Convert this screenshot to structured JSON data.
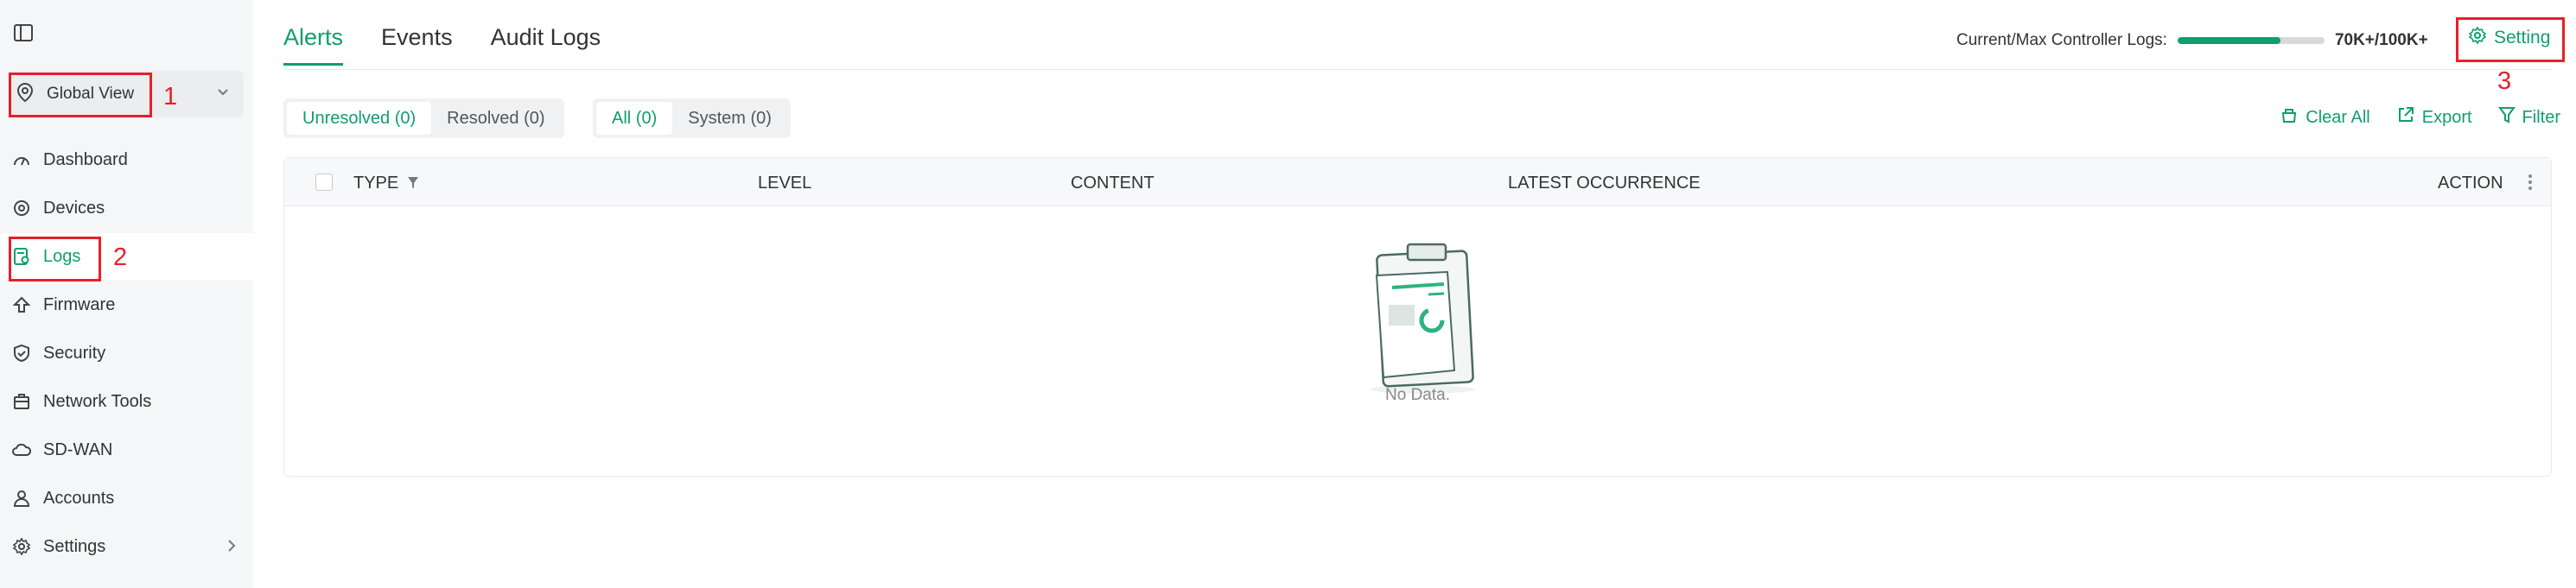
{
  "sidebar": {
    "site_selector": {
      "label": "Global View"
    },
    "items": [
      {
        "label": "Dashboard",
        "icon": "dashboard-icon"
      },
      {
        "label": "Devices",
        "icon": "devices-icon"
      },
      {
        "label": "Logs",
        "icon": "logs-icon",
        "active": true
      },
      {
        "label": "Firmware",
        "icon": "firmware-icon"
      },
      {
        "label": "Security",
        "icon": "shield-icon"
      },
      {
        "label": "Network Tools",
        "icon": "toolbox-icon"
      },
      {
        "label": "SD-WAN",
        "icon": "cloud-icon"
      },
      {
        "label": "Accounts",
        "icon": "user-icon"
      },
      {
        "label": "Settings",
        "icon": "gear-icon"
      }
    ]
  },
  "annotations": {
    "one": "1",
    "two": "2",
    "three": "3"
  },
  "tabs": [
    {
      "label": "Alerts",
      "active": true
    },
    {
      "label": "Events"
    },
    {
      "label": "Audit Logs"
    }
  ],
  "log_usage": {
    "label": "Current/Max Controller Logs:",
    "value": "70K+/100K+",
    "fill_ratio": 0.7
  },
  "setting_button": {
    "label": "Setting"
  },
  "filters": {
    "status": [
      {
        "label": "Unresolved (0)",
        "active": true
      },
      {
        "label": "Resolved (0)"
      }
    ],
    "category": [
      {
        "label": "All (0)",
        "active": true
      },
      {
        "label": "System (0)"
      }
    ]
  },
  "toolbar": {
    "clear_all": "Clear All",
    "export": "Export",
    "filter": "Filter"
  },
  "table": {
    "columns": [
      "TYPE",
      "LEVEL",
      "CONTENT",
      "LATEST OCCURRENCE",
      "ACTION"
    ],
    "empty_text": "No Data."
  },
  "colors": {
    "accent": "#0e9f6e",
    "annotation": "#e5202a",
    "sidebar_bg": "#f5f6f7"
  }
}
